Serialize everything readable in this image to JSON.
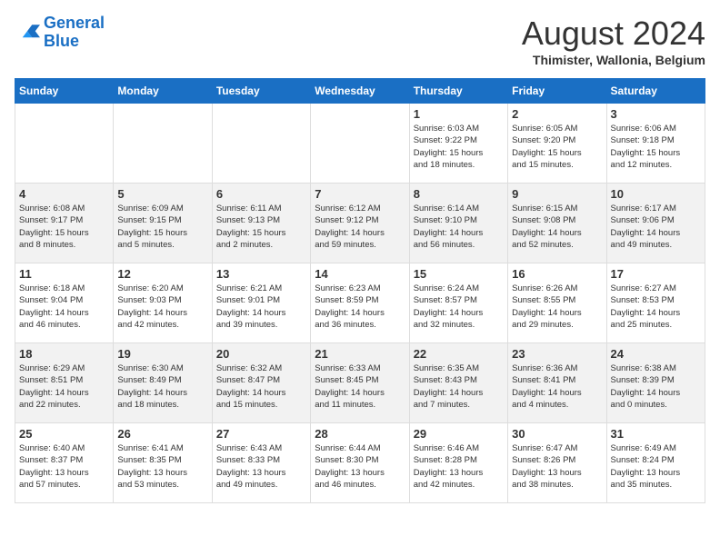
{
  "header": {
    "logo_line1": "General",
    "logo_line2": "Blue",
    "month": "August 2024",
    "location": "Thimister, Wallonia, Belgium"
  },
  "weekdays": [
    "Sunday",
    "Monday",
    "Tuesday",
    "Wednesday",
    "Thursday",
    "Friday",
    "Saturday"
  ],
  "weeks": [
    [
      {
        "day": "",
        "info": ""
      },
      {
        "day": "",
        "info": ""
      },
      {
        "day": "",
        "info": ""
      },
      {
        "day": "",
        "info": ""
      },
      {
        "day": "1",
        "info": "Sunrise: 6:03 AM\nSunset: 9:22 PM\nDaylight: 15 hours\nand 18 minutes."
      },
      {
        "day": "2",
        "info": "Sunrise: 6:05 AM\nSunset: 9:20 PM\nDaylight: 15 hours\nand 15 minutes."
      },
      {
        "day": "3",
        "info": "Sunrise: 6:06 AM\nSunset: 9:18 PM\nDaylight: 15 hours\nand 12 minutes."
      }
    ],
    [
      {
        "day": "4",
        "info": "Sunrise: 6:08 AM\nSunset: 9:17 PM\nDaylight: 15 hours\nand 8 minutes."
      },
      {
        "day": "5",
        "info": "Sunrise: 6:09 AM\nSunset: 9:15 PM\nDaylight: 15 hours\nand 5 minutes."
      },
      {
        "day": "6",
        "info": "Sunrise: 6:11 AM\nSunset: 9:13 PM\nDaylight: 15 hours\nand 2 minutes."
      },
      {
        "day": "7",
        "info": "Sunrise: 6:12 AM\nSunset: 9:12 PM\nDaylight: 14 hours\nand 59 minutes."
      },
      {
        "day": "8",
        "info": "Sunrise: 6:14 AM\nSunset: 9:10 PM\nDaylight: 14 hours\nand 56 minutes."
      },
      {
        "day": "9",
        "info": "Sunrise: 6:15 AM\nSunset: 9:08 PM\nDaylight: 14 hours\nand 52 minutes."
      },
      {
        "day": "10",
        "info": "Sunrise: 6:17 AM\nSunset: 9:06 PM\nDaylight: 14 hours\nand 49 minutes."
      }
    ],
    [
      {
        "day": "11",
        "info": "Sunrise: 6:18 AM\nSunset: 9:04 PM\nDaylight: 14 hours\nand 46 minutes."
      },
      {
        "day": "12",
        "info": "Sunrise: 6:20 AM\nSunset: 9:03 PM\nDaylight: 14 hours\nand 42 minutes."
      },
      {
        "day": "13",
        "info": "Sunrise: 6:21 AM\nSunset: 9:01 PM\nDaylight: 14 hours\nand 39 minutes."
      },
      {
        "day": "14",
        "info": "Sunrise: 6:23 AM\nSunset: 8:59 PM\nDaylight: 14 hours\nand 36 minutes."
      },
      {
        "day": "15",
        "info": "Sunrise: 6:24 AM\nSunset: 8:57 PM\nDaylight: 14 hours\nand 32 minutes."
      },
      {
        "day": "16",
        "info": "Sunrise: 6:26 AM\nSunset: 8:55 PM\nDaylight: 14 hours\nand 29 minutes."
      },
      {
        "day": "17",
        "info": "Sunrise: 6:27 AM\nSunset: 8:53 PM\nDaylight: 14 hours\nand 25 minutes."
      }
    ],
    [
      {
        "day": "18",
        "info": "Sunrise: 6:29 AM\nSunset: 8:51 PM\nDaylight: 14 hours\nand 22 minutes."
      },
      {
        "day": "19",
        "info": "Sunrise: 6:30 AM\nSunset: 8:49 PM\nDaylight: 14 hours\nand 18 minutes."
      },
      {
        "day": "20",
        "info": "Sunrise: 6:32 AM\nSunset: 8:47 PM\nDaylight: 14 hours\nand 15 minutes."
      },
      {
        "day": "21",
        "info": "Sunrise: 6:33 AM\nSunset: 8:45 PM\nDaylight: 14 hours\nand 11 minutes."
      },
      {
        "day": "22",
        "info": "Sunrise: 6:35 AM\nSunset: 8:43 PM\nDaylight: 14 hours\nand 7 minutes."
      },
      {
        "day": "23",
        "info": "Sunrise: 6:36 AM\nSunset: 8:41 PM\nDaylight: 14 hours\nand 4 minutes."
      },
      {
        "day": "24",
        "info": "Sunrise: 6:38 AM\nSunset: 8:39 PM\nDaylight: 14 hours\nand 0 minutes."
      }
    ],
    [
      {
        "day": "25",
        "info": "Sunrise: 6:40 AM\nSunset: 8:37 PM\nDaylight: 13 hours\nand 57 minutes."
      },
      {
        "day": "26",
        "info": "Sunrise: 6:41 AM\nSunset: 8:35 PM\nDaylight: 13 hours\nand 53 minutes."
      },
      {
        "day": "27",
        "info": "Sunrise: 6:43 AM\nSunset: 8:33 PM\nDaylight: 13 hours\nand 49 minutes."
      },
      {
        "day": "28",
        "info": "Sunrise: 6:44 AM\nSunset: 8:30 PM\nDaylight: 13 hours\nand 46 minutes."
      },
      {
        "day": "29",
        "info": "Sunrise: 6:46 AM\nSunset: 8:28 PM\nDaylight: 13 hours\nand 42 minutes."
      },
      {
        "day": "30",
        "info": "Sunrise: 6:47 AM\nSunset: 8:26 PM\nDaylight: 13 hours\nand 38 minutes."
      },
      {
        "day": "31",
        "info": "Sunrise: 6:49 AM\nSunset: 8:24 PM\nDaylight: 13 hours\nand 35 minutes."
      }
    ]
  ]
}
